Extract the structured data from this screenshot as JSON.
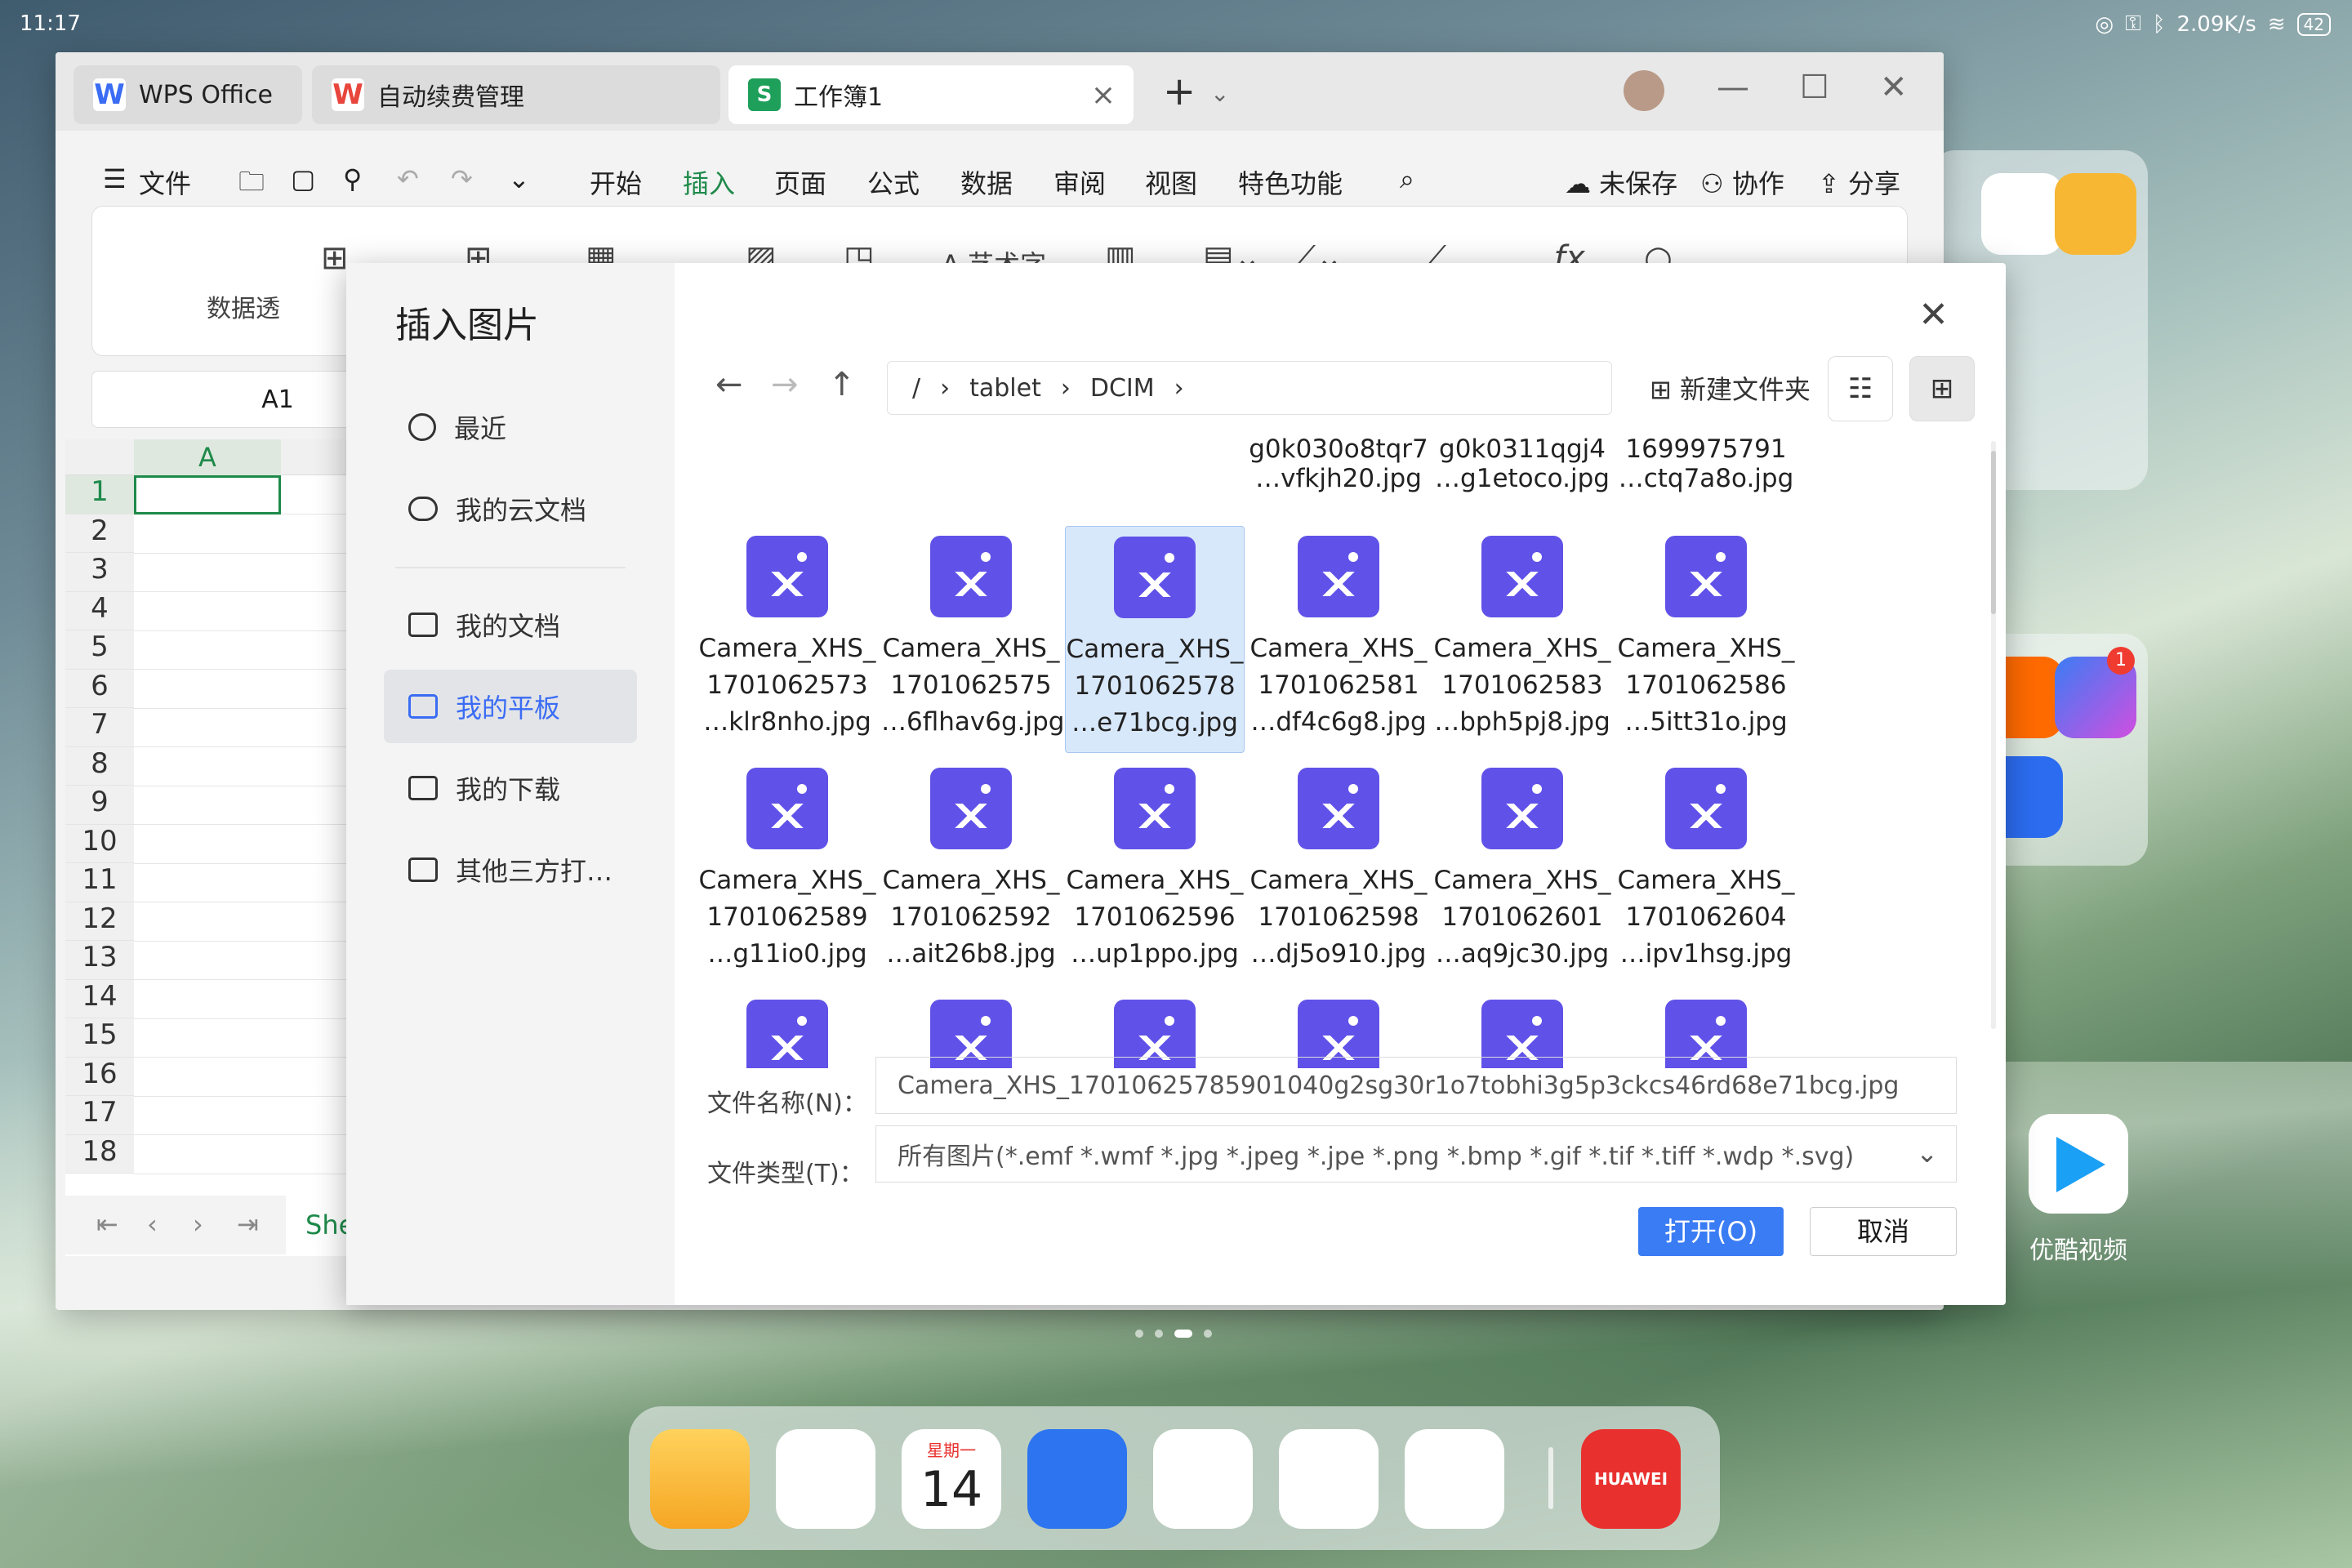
{
  "status": {
    "time": "11:17",
    "speed": "2.09K/s",
    "battery": "42"
  },
  "tabs": [
    {
      "label": "WPS Office"
    },
    {
      "label": "自动续费管理"
    },
    {
      "label": "工作簿1"
    }
  ],
  "menu": {
    "file": "文件",
    "items": [
      "开始",
      "插入",
      "页面",
      "公式",
      "数据",
      "审阅",
      "视图",
      "特色功能"
    ],
    "active": "插入",
    "unsaved": "未保存",
    "collab": "协作",
    "share": "分享"
  },
  "ribbon": {
    "wordart": "艺术字",
    "pivot": "数据透"
  },
  "sheet": {
    "namebox": "A1",
    "col": "A",
    "rows": [
      "1",
      "2",
      "3",
      "4",
      "5",
      "6",
      "7",
      "8",
      "9",
      "10",
      "11",
      "12",
      "13",
      "14",
      "15",
      "16",
      "17",
      "18"
    ],
    "tab": "Shee"
  },
  "dialog": {
    "title": "插入图片",
    "sidebar": [
      {
        "label": "最近",
        "icon": "clock-icon"
      },
      {
        "label": "我的云文档",
        "icon": "cloud-icon"
      },
      {
        "label": "我的文档",
        "icon": "folder-icon"
      },
      {
        "label": "我的平板",
        "icon": "tablet-folder-icon",
        "active": true
      },
      {
        "label": "我的下载",
        "icon": "download-folder-icon"
      },
      {
        "label": "其他三方打…",
        "icon": "third-party-folder-icon"
      }
    ],
    "path": [
      "/",
      "tablet",
      "DCIM"
    ],
    "new_folder": "新建文件夹",
    "partial_row": [
      {
        "l1": "g0k030o8tqr7",
        "l2": "…vfkjh20.jpg"
      },
      {
        "l1": "g0k0311qgj4",
        "l2": "…g1etoco.jpg"
      },
      {
        "l1": "1699975791",
        "l2": "…ctq7a8o.jpg"
      }
    ],
    "files": [
      {
        "l1": "Camera_XHS_",
        "l2": "1701062573",
        "l3": "…klr8nho.jpg"
      },
      {
        "l1": "Camera_XHS_",
        "l2": "1701062575",
        "l3": "…6flhav6g.jpg"
      },
      {
        "l1": "Camera_XHS_",
        "l2": "1701062578",
        "l3": "…e71bcg.jpg",
        "selected": true
      },
      {
        "l1": "Camera_XHS_",
        "l2": "1701062581",
        "l3": "…df4c6g8.jpg"
      },
      {
        "l1": "Camera_XHS_",
        "l2": "1701062583",
        "l3": "…bph5pj8.jpg"
      },
      {
        "l1": "Camera_XHS_",
        "l2": "1701062586",
        "l3": "…5itt31o.jpg"
      },
      {
        "l1": "Camera_XHS_",
        "l2": "1701062589",
        "l3": "…g11io0.jpg"
      },
      {
        "l1": "Camera_XHS_",
        "l2": "1701062592",
        "l3": "…ait26b8.jpg"
      },
      {
        "l1": "Camera_XHS_",
        "l2": "1701062596",
        "l3": "…up1ppo.jpg"
      },
      {
        "l1": "Camera_XHS_",
        "l2": "1701062598",
        "l3": "…dj5o910.jpg"
      },
      {
        "l1": "Camera_XHS_",
        "l2": "1701062601",
        "l3": "…aq9jc30.jpg"
      },
      {
        "l1": "Camera_XHS_",
        "l2": "1701062604",
        "l3": "…ipv1hsg.jpg"
      }
    ],
    "filename_label": "文件名称(N)：",
    "filename_value": "Camera_XHS_17010625785901040g2sg30r1o7tobhi3g5p3ckcs46rd68e71bcg.jpg",
    "filetype_label": "文件类型(T)：",
    "filetype_value": "所有图片(*.emf *.wmf *.jpg *.jpeg *.jpe *.png *.bmp *.gif *.tif *.tiff *.wdp *.svg)",
    "open": "打开(O)",
    "cancel": "取消"
  },
  "home": {
    "youku": "优酷视频",
    "music_badge": "1",
    "calendar_weekday": "星期一",
    "calendar_day": "14",
    "huawei": "HUAWEI"
  }
}
